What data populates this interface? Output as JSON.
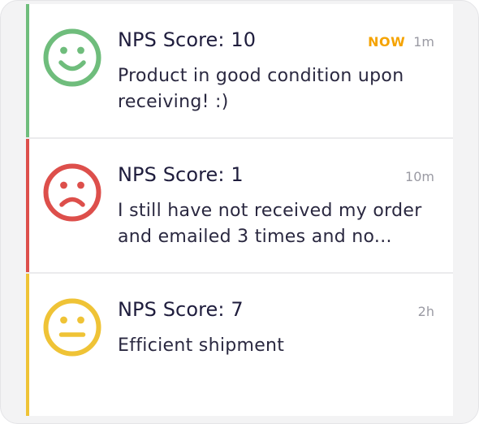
{
  "colors": {
    "positive": "#6fbd7c",
    "negative": "#dd4f4b",
    "neutral": "#efc336",
    "badge": "#f5a300"
  },
  "feed": [
    {
      "sentiment": "positive",
      "icon": "smiley-face-icon",
      "title": "NPS Score: 10",
      "badge": "NOW",
      "time": "1m",
      "message": "Product in good condition upon receiving! :)"
    },
    {
      "sentiment": "negative",
      "icon": "sad-face-icon",
      "title": "NPS Score: 1",
      "badge": "",
      "time": "10m",
      "message": "I still have not received my order and emailed 3 times and no..."
    },
    {
      "sentiment": "neutral",
      "icon": "neutral-face-icon",
      "title": "NPS Score: 7",
      "badge": "",
      "time": "2h",
      "message": "Efficient shipment"
    }
  ]
}
